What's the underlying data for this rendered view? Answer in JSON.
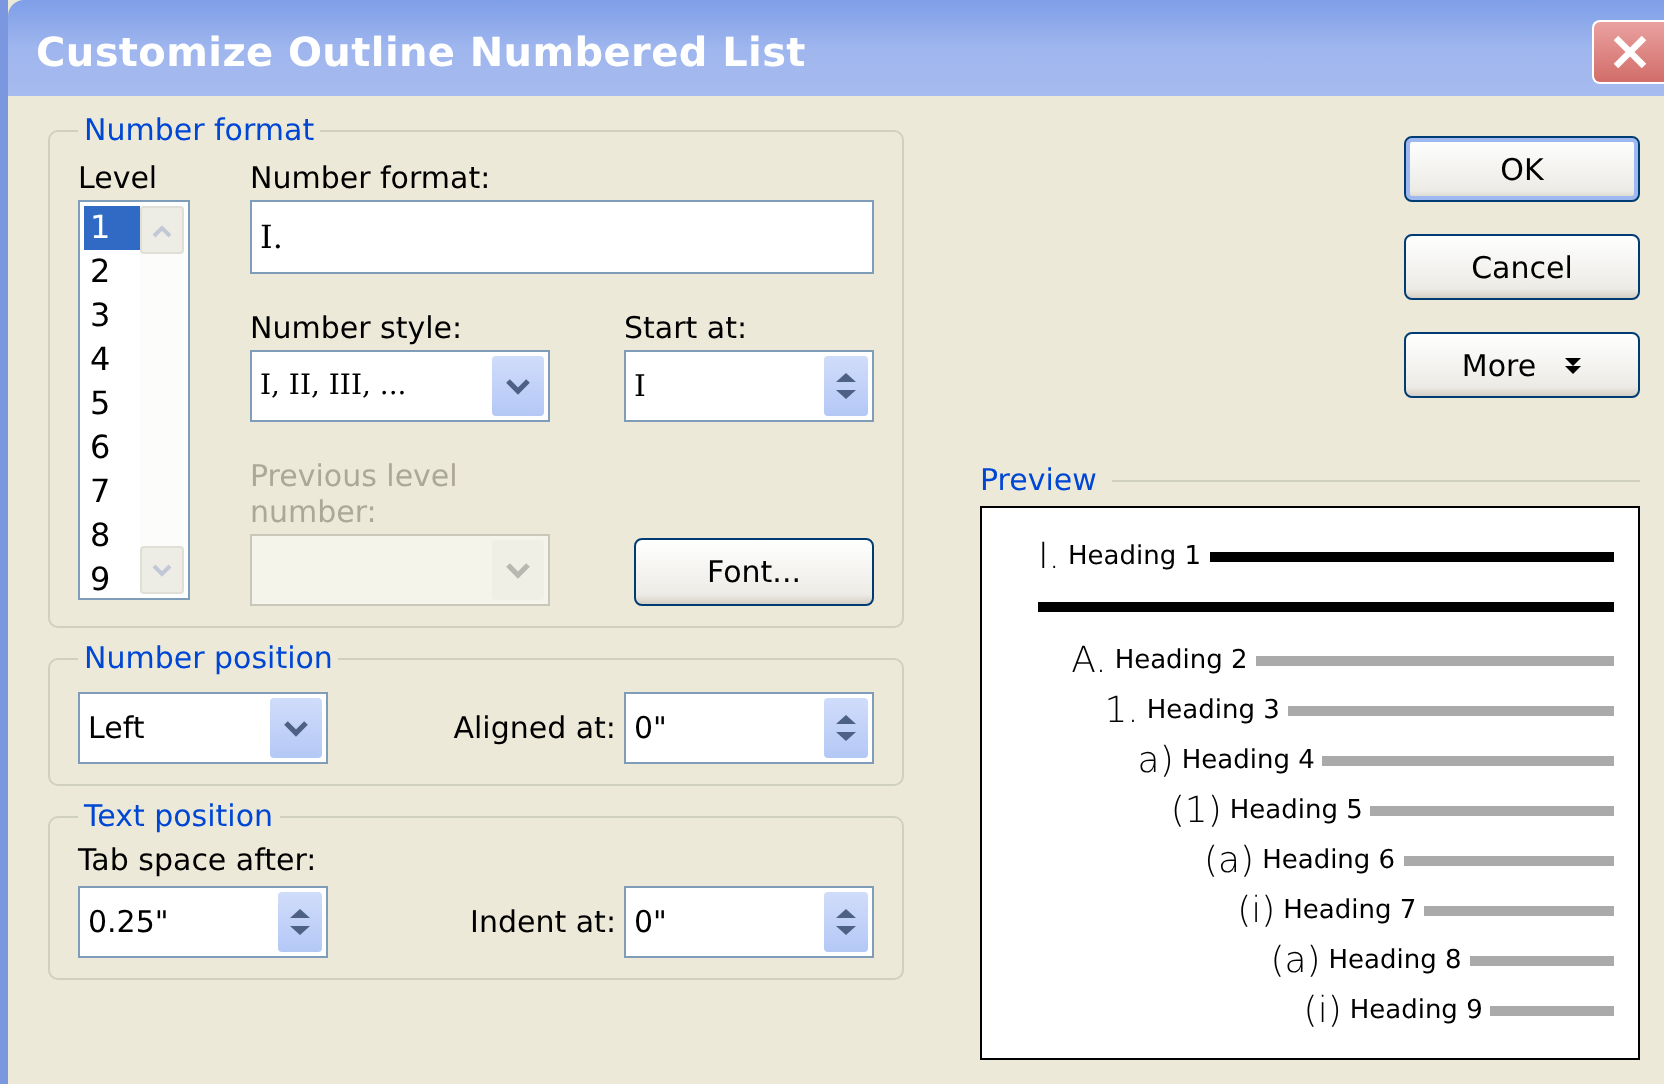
{
  "window": {
    "title": "Customize Outline Numbered List"
  },
  "number_format_group": {
    "legend": "Number format",
    "level": {
      "label": "Level",
      "items": [
        {
          "label": "1",
          "selected": true
        },
        {
          "label": "2",
          "selected": false
        },
        {
          "label": "3",
          "selected": false
        },
        {
          "label": "4",
          "selected": false
        },
        {
          "label": "5",
          "selected": false
        },
        {
          "label": "6",
          "selected": false
        },
        {
          "label": "7",
          "selected": false
        },
        {
          "label": "8",
          "selected": false
        },
        {
          "label": "9",
          "selected": false
        }
      ]
    },
    "number_format": {
      "label": "Number format:",
      "value": "I."
    },
    "number_style": {
      "label": "Number style:",
      "value": "I, II, III, ..."
    },
    "start_at": {
      "label": "Start at:",
      "value": "I"
    },
    "previous_level_number": {
      "label": "Previous level number:",
      "disabled": true
    },
    "font_button": "Font..."
  },
  "number_position_group": {
    "legend": "Number position",
    "alignment": {
      "value": "Left"
    },
    "aligned_at": {
      "label": "Aligned at:",
      "value": "0\""
    }
  },
  "text_position_group": {
    "legend": "Text position",
    "tab_space_after": {
      "label": "Tab space after:",
      "value": "0.25\""
    },
    "indent_at": {
      "label": "Indent at:",
      "value": "0\""
    }
  },
  "buttons": [
    {
      "label": "OK",
      "default": true,
      "kind": "plain"
    },
    {
      "label": "Cancel",
      "default": false,
      "kind": "plain"
    },
    {
      "label": "More",
      "default": false,
      "kind": "menu"
    }
  ],
  "preview": {
    "legend": "Preview",
    "headings": [
      {
        "number": "I.",
        "text": "Heading 1",
        "kind": "major",
        "children": [
          {
            "number": "A.",
            "text": "Heading 2",
            "kind": "minor",
            "children": [
              {
                "number": "1.",
                "text": "Heading 3",
                "kind": "minor",
                "children": [
                  {
                    "number": "a)",
                    "text": "Heading 4",
                    "kind": "minor",
                    "children": [
                      {
                        "number": "(1)",
                        "text": "Heading 5",
                        "kind": "minor",
                        "children": [
                          {
                            "number": "(a)",
                            "text": "Heading 6",
                            "kind": "minor",
                            "children": [
                              {
                                "number": "(i)",
                                "text": "Heading 7",
                                "kind": "minor",
                                "children": [
                                  {
                                    "number": "(a)",
                                    "text": "Heading 8",
                                    "kind": "minor",
                                    "children": [
                                      {
                                        "number": "(i)",
                                        "text": "Heading 9",
                                        "kind": "minor"
                                      }
                                    ]
                                  }
                                ]
                              }
                            ]
                          }
                        ]
                      }
                    ]
                  }
                ]
              }
            ]
          }
        ]
      }
    ]
  }
}
